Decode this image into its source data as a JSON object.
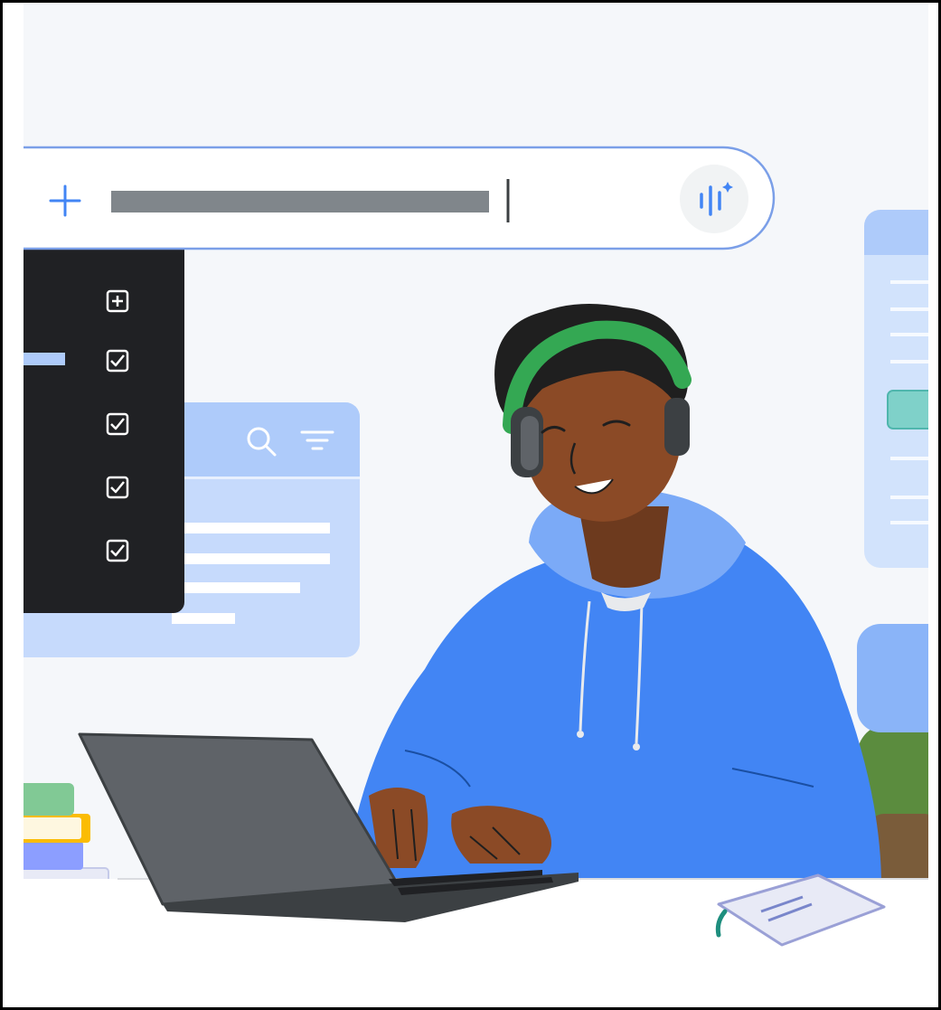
{
  "prompt_bar": {
    "add_icon": "plus-icon",
    "text_placeholder": "gray-text-redaction-bar",
    "mic_icon": "voice-sparkle-icon"
  },
  "task_panel": {
    "icons": [
      "add-box-icon",
      "checkbox-checked-icon",
      "checkbox-checked-icon",
      "checkbox-checked-icon",
      "checkbox-checked-icon"
    ]
  },
  "search_card": {
    "icons": [
      "search-icon",
      "filter-icon"
    ]
  },
  "colors": {
    "background": "#f5f7fa",
    "hoodie_blue": "#4285f4",
    "hoodie_light": "#7baaf7",
    "skin": "#8b4a26",
    "hair": "#1f1f1f",
    "headphones_green": "#34a853",
    "laptop_gray": "#5f6368",
    "panel_dark": "#202124",
    "card_blue": "#aecbfa",
    "prompt_border": "#7b9fe8",
    "gray_bar": "#80868b"
  }
}
